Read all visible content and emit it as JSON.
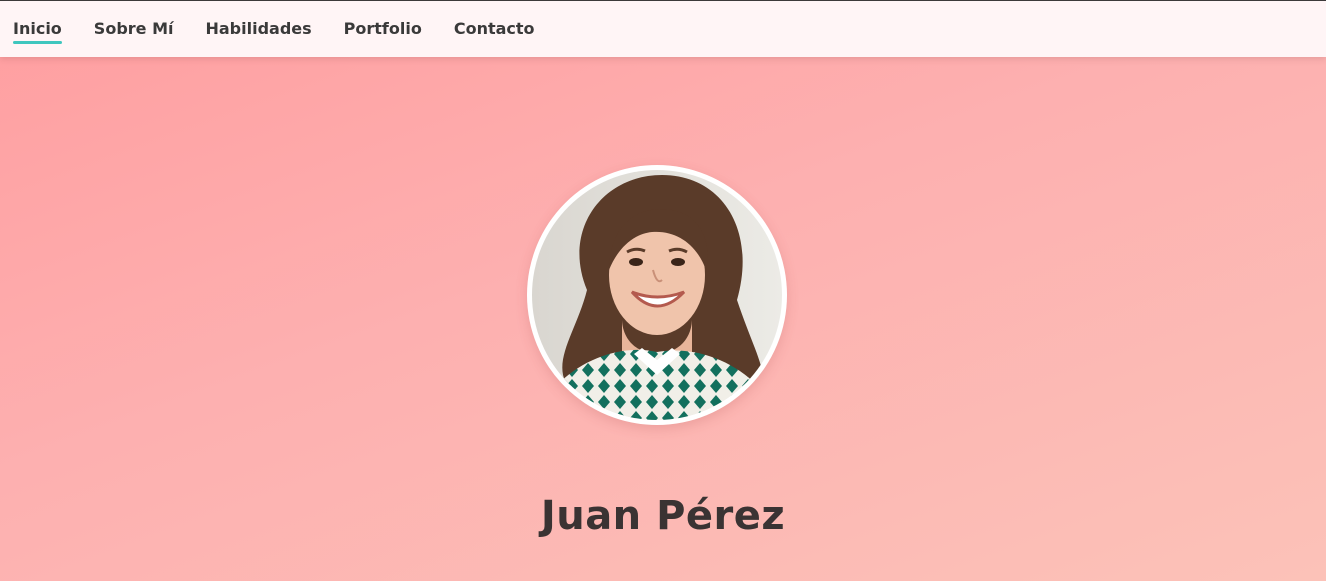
{
  "nav": {
    "items": [
      {
        "label": "Inicio",
        "active": true
      },
      {
        "label": "Sobre Mí",
        "active": false
      },
      {
        "label": "Habilidades",
        "active": false
      },
      {
        "label": "Portfolio",
        "active": false
      },
      {
        "label": "Contacto",
        "active": false
      }
    ]
  },
  "hero": {
    "name": "Juan Pérez"
  },
  "colors": {
    "accent": "#3fc6be",
    "background_start": "#ff9ea0",
    "background_end": "#fcc2b8",
    "navbar": "#fff5f6",
    "text": "#3a3a3a"
  }
}
